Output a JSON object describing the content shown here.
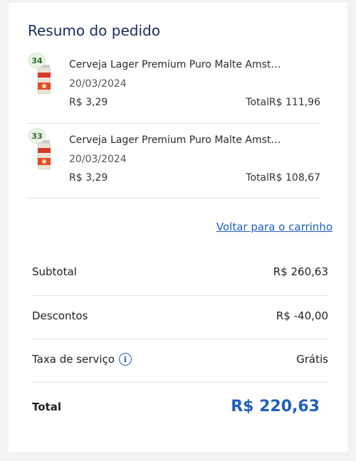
{
  "summary": {
    "title": "Resumo do pedido",
    "items": [
      {
        "qty": "34",
        "name": "Cerveja Lager Premium Puro Malte Amst…",
        "date": "20/03/2024",
        "unit_price": "R$ 3,29",
        "total_label": "Total",
        "total": "R$ 111,96"
      },
      {
        "qty": "33",
        "name": "Cerveja Lager Premium Puro Malte Amst…",
        "date": "20/03/2024",
        "unit_price": "R$ 3,29",
        "total_label": "Total",
        "total": "R$ 108,67"
      }
    ],
    "back_link": "Voltar para o carrinho",
    "subtotal_label": "Subtotal",
    "subtotal": "R$ 260,63",
    "discounts_label": "Descontos",
    "discounts": "R$ -40,00",
    "service_fee_label": "Taxa de serviço",
    "service_fee": "Grátis",
    "total_label": "Total",
    "total": "R$ 220,63"
  },
  "icons": {
    "product_image": "beer-can-icon",
    "info": "info-icon"
  },
  "colors": {
    "accent": "#1f5fbf",
    "title": "#1b2b5c",
    "badge_bg": "#eaf5e6",
    "badge_text": "#2d6a2a"
  }
}
